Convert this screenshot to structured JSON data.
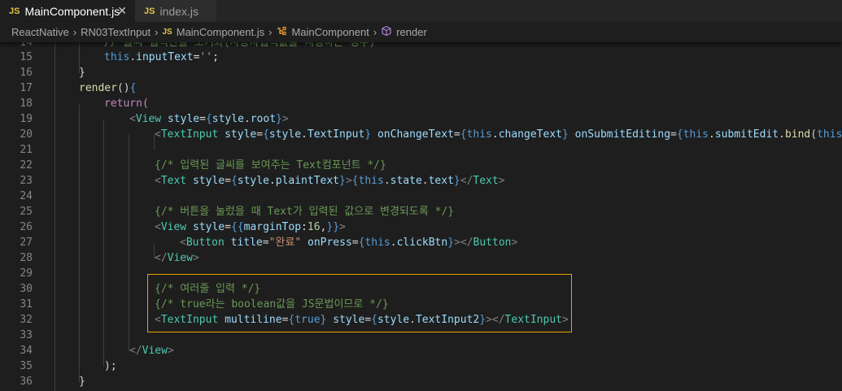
{
  "tabs": [
    {
      "label": "MainComponent.js",
      "badge": "JS",
      "active": true
    },
    {
      "label": "index.js",
      "badge": "JS",
      "active": false
    }
  ],
  "breadcrumb": {
    "items": [
      "ReactNative",
      "RN03TextInput",
      "MainComponent.js",
      "MainComponent",
      "render"
    ],
    "separator": "›"
  },
  "editor": {
    "lines": [
      {
        "no": "14",
        "text": "// 글씨 입력칸을 초기화(사용자입력값을 지정하는 경우)"
      },
      {
        "no": "15",
        "text": "this.inputText='';"
      },
      {
        "no": "16",
        "text": "}"
      },
      {
        "no": "17",
        "text": "render(){"
      },
      {
        "no": "18",
        "text": "return("
      },
      {
        "no": "19",
        "text": "<View style={style.root}>"
      },
      {
        "no": "20",
        "text": "<TextInput style={style.TextInput} onChangeText={this.changeText} onSubmitEditing={this.submitEdit.bind(this)}"
      },
      {
        "no": "21",
        "text": ""
      },
      {
        "no": "22",
        "text": "{/* 입력된 글씨를 보여주는 Text컴포넌트 */}"
      },
      {
        "no": "23",
        "text": "<Text style={style.plaintText}>{this.state.text}</Text>"
      },
      {
        "no": "24",
        "text": ""
      },
      {
        "no": "25",
        "text": "{/* 버튼을 눌렀을 때 Text가 입력된 값으로 변경되도록 */}"
      },
      {
        "no": "26",
        "text": "<View style={{marginTop:16,}}>"
      },
      {
        "no": "27",
        "text": "<Button title=\"완료\" onPress={this.clickBtn}></Button>"
      },
      {
        "no": "28",
        "text": "</View>"
      },
      {
        "no": "29",
        "text": ""
      },
      {
        "no": "30",
        "text": "{/* 여러줄 입력 */}"
      },
      {
        "no": "31",
        "text": "{/* true라는 boolean값을 JS문법이므로 */}"
      },
      {
        "no": "32",
        "text": "<TextInput multiline={true} style={style.TextInput2}></TextInput>"
      },
      {
        "no": "33",
        "text": ""
      },
      {
        "no": "34",
        "text": "</View>"
      },
      {
        "no": "35",
        "text": ");"
      },
      {
        "no": "36",
        "text": "}"
      }
    ]
  }
}
